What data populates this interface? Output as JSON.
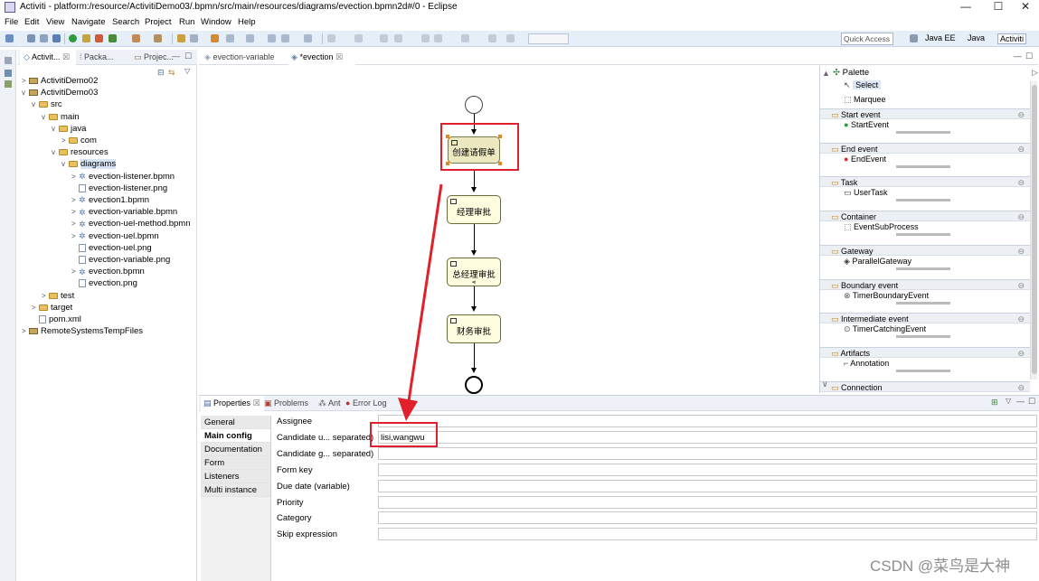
{
  "window": {
    "title": "Activiti - platform:/resource/ActivitiDemo03/.bpmn/src/main/resources/diagrams/evection.bpmn2d#/0 - Eclipse",
    "minimize": "—",
    "maximize": "☐",
    "close": "✕"
  },
  "menu": [
    "File",
    "Edit",
    "View",
    "Navigate",
    "Search",
    "Project",
    "Run",
    "Window",
    "Help"
  ],
  "toolbar": {
    "quick_access_placeholder": "Quick Access",
    "perspectives": [
      "Java EE",
      "Java",
      "Activiti"
    ]
  },
  "explorer": {
    "tabs": [
      "Activit...",
      "Packa...",
      "Projec..."
    ],
    "tree": [
      {
        "label": "ActivitiDemo02",
        "depth": 0,
        "arrow": ">",
        "icon": "project"
      },
      {
        "label": "ActivitiDemo03",
        "depth": 0,
        "arrow": "v",
        "icon": "project"
      },
      {
        "label": "src",
        "depth": 1,
        "arrow": "v",
        "icon": "folder"
      },
      {
        "label": "main",
        "depth": 2,
        "arrow": "v",
        "icon": "folder"
      },
      {
        "label": "java",
        "depth": 3,
        "arrow": "v",
        "icon": "folder"
      },
      {
        "label": "com",
        "depth": 4,
        "arrow": ">",
        "icon": "folder"
      },
      {
        "label": "resources",
        "depth": 3,
        "arrow": "v",
        "icon": "folder"
      },
      {
        "label": "diagrams",
        "depth": 4,
        "arrow": "v",
        "icon": "folder",
        "selected": true
      },
      {
        "label": "evection-listener.bpmn",
        "depth": 5,
        "arrow": ">",
        "icon": "bpmn"
      },
      {
        "label": "evection-listener.png",
        "depth": 5,
        "arrow": "",
        "icon": "file"
      },
      {
        "label": "evection1.bpmn",
        "depth": 5,
        "arrow": ">",
        "icon": "bpmn"
      },
      {
        "label": "evection-variable.bpmn",
        "depth": 5,
        "arrow": ">",
        "icon": "bpmn"
      },
      {
        "label": "evection-uel-method.bpmn",
        "depth": 5,
        "arrow": ">",
        "icon": "bpmn"
      },
      {
        "label": "evection-uel.bpmn",
        "depth": 5,
        "arrow": ">",
        "icon": "bpmn"
      },
      {
        "label": "evection-uel.png",
        "depth": 5,
        "arrow": "",
        "icon": "file"
      },
      {
        "label": "evection-variable.png",
        "depth": 5,
        "arrow": "",
        "icon": "file"
      },
      {
        "label": "evection.bpmn",
        "depth": 5,
        "arrow": ">",
        "icon": "bpmn"
      },
      {
        "label": "evection.png",
        "depth": 5,
        "arrow": "",
        "icon": "file"
      },
      {
        "label": "test",
        "depth": 2,
        "arrow": ">",
        "icon": "folder"
      },
      {
        "label": "target",
        "depth": 1,
        "arrow": ">",
        "icon": "folder"
      },
      {
        "label": "pom.xml",
        "depth": 1,
        "arrow": "",
        "icon": "file"
      },
      {
        "label": "RemoteSystemsTempFiles",
        "depth": 0,
        "arrow": ">",
        "icon": "project"
      }
    ]
  },
  "editor": {
    "tabs": [
      "evection-variable",
      "*evection"
    ],
    "tasks": [
      "创建请假单",
      "经理审批",
      "总经理审批",
      "财务审批"
    ]
  },
  "palette": {
    "title": "Palette",
    "tools": [
      "Select",
      "Marquee"
    ],
    "drawers": [
      {
        "label": "Start event",
        "item": "StartEvent"
      },
      {
        "label": "End event",
        "item": "EndEvent"
      },
      {
        "label": "Task",
        "item": "UserTask"
      },
      {
        "label": "Container",
        "item": "EventSubProcess"
      },
      {
        "label": "Gateway",
        "item": "ParallelGateway"
      },
      {
        "label": "Boundary event",
        "item": "TimerBoundaryEvent"
      },
      {
        "label": "Intermediate event",
        "item": "TimerCatchingEvent"
      },
      {
        "label": "Artifacts",
        "item": "Annotation"
      },
      {
        "label": "Connection",
        "item": ""
      }
    ]
  },
  "properties": {
    "tabs": [
      "Properties",
      "Problems",
      "Ant",
      "Error Log"
    ],
    "sections": [
      "General",
      "Main config",
      "Documentation",
      "Form",
      "Listeners",
      "Multi instance"
    ],
    "active_section": "Main config",
    "fields": [
      {
        "label": "Assignee",
        "value": ""
      },
      {
        "label": "Candidate u... separated)",
        "value": "lisi,wangwu"
      },
      {
        "label": "Candidate g... separated)",
        "value": ""
      },
      {
        "label": "Form key",
        "value": ""
      },
      {
        "label": "Due date (variable)",
        "value": ""
      },
      {
        "label": "Priority",
        "value": ""
      },
      {
        "label": "Category",
        "value": ""
      },
      {
        "label": "Skip expression",
        "value": ""
      }
    ]
  },
  "watermark": "CSDN @菜鸟是大神",
  "colors": {
    "highlight": "#e0202a",
    "task_fill": "#fffde0",
    "selected_task_fill": "#ece9c0",
    "toolbar_bg": "#e6eef8"
  }
}
